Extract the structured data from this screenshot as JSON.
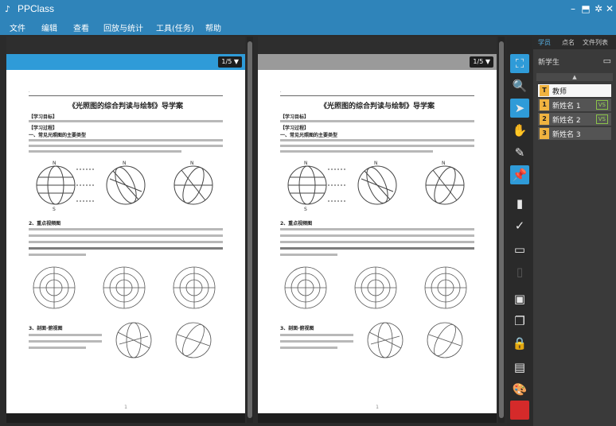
{
  "app": {
    "title": "PPClass"
  },
  "window_controls": {
    "minimize": "–",
    "restore": "⬒",
    "settings": "✲",
    "close": "✕"
  },
  "menu": [
    "文件",
    "编辑",
    "查看",
    "回放与统计",
    "工具(任务)",
    "帮助"
  ],
  "panes": [
    {
      "page_button": "1/5 ▼"
    },
    {
      "page_button": "1/5 ▼"
    }
  ],
  "document": {
    "title": "《光照图的综合判读与绘制》导学案",
    "heading_objectives": "【学习目标】",
    "heading_process": "【学习过程】",
    "section1": "一、常见光照图的主要类型",
    "section2": "2、重点视频图",
    "section3": "3、剖面·俯视图",
    "page_number": "1"
  },
  "tools": [
    {
      "icon": "screen-icon",
      "glyph": "⛶",
      "state": "active"
    },
    {
      "icon": "zoom-icon",
      "glyph": "🔍",
      "state": "dim"
    },
    {
      "icon": "cursor-icon",
      "glyph": "➤",
      "state": "active"
    },
    {
      "icon": "hand-icon",
      "glyph": "✋",
      "state": "normal"
    },
    {
      "icon": "pen-icon",
      "glyph": "✎",
      "state": "normal"
    },
    {
      "icon": "pin-icon",
      "glyph": "📌",
      "state": "active"
    },
    {
      "icon": "bar-chart-icon",
      "glyph": "▮",
      "state": "normal"
    },
    {
      "icon": "survey-icon",
      "glyph": "✓",
      "state": "normal"
    },
    {
      "icon": "folder-open-icon",
      "glyph": "▭",
      "state": "normal"
    },
    {
      "icon": "document-icon",
      "glyph": "▯",
      "state": "dim"
    },
    {
      "icon": "window-icon",
      "glyph": "▣",
      "state": "normal"
    },
    {
      "icon": "copy-icon",
      "glyph": "❐",
      "state": "normal"
    },
    {
      "icon": "lock-icon",
      "glyph": "🔒",
      "state": "normal"
    },
    {
      "icon": "card-icon",
      "glyph": "▤",
      "state": "normal"
    },
    {
      "icon": "palette-icon",
      "glyph": "🎨",
      "state": "normal"
    },
    {
      "icon": "color-swatch-icon",
      "glyph": "",
      "state": "red"
    }
  ],
  "right_panel": {
    "tabs": [
      "学员",
      "点名",
      "文件列表"
    ],
    "new_student_label": "新学生",
    "collapse_glyph": "▲",
    "students": [
      {
        "badge": "T",
        "name": "教师",
        "role": "teacher",
        "vs": ""
      },
      {
        "badge": "1",
        "name": "新姓名 1",
        "role": "student",
        "vs": "VS"
      },
      {
        "badge": "2",
        "name": "新姓名 2",
        "role": "student",
        "vs": "VS"
      },
      {
        "badge": "3",
        "name": "新姓名 3",
        "role": "student",
        "vs": ""
      }
    ]
  },
  "colors": {
    "accent": "#2f84ba",
    "highlight": "#2f9bd8",
    "badge": "#f0b340",
    "swatch": "#d52a2a"
  }
}
